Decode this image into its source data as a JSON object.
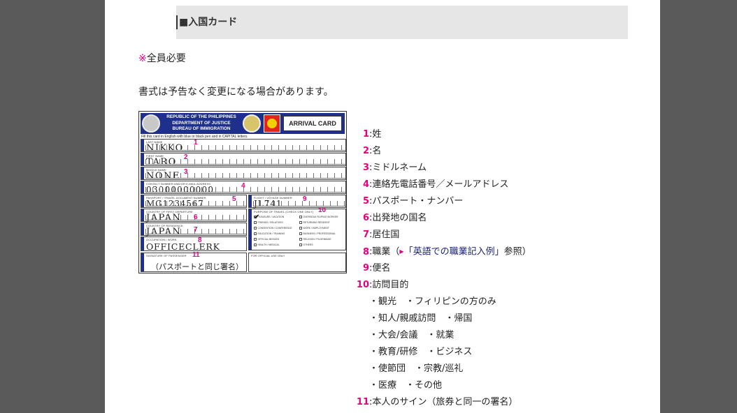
{
  "header": {
    "title": "■入国カード"
  },
  "note": {
    "mark": "※",
    "text": "全員必要"
  },
  "disclaimer": "書式は予告なく変更になる場合があります。",
  "card": {
    "head_lines": [
      "REPUBLIC OF THE PHILIPPINES",
      "DEPARTMENT OF JUSTICE",
      "BUREAU OF IMMIGRATION"
    ],
    "badge": "ARRIVAL CARD",
    "instruction": "Fill this card in English with blue or black pen and in CAPITAL letters.",
    "fields": {
      "last_name": {
        "label": "LAST NAME",
        "value": "NIKKO"
      },
      "first_name": {
        "label": "FIRST NAME",
        "value": "TARO"
      },
      "middle_name": {
        "label": "MIDDLE NAME",
        "value": "NONE"
      },
      "contact": {
        "label": "CONTACT NUMBER AND/OR E-MAIL ADDRESS",
        "value": "03000000000"
      },
      "passport": {
        "label": "PASSPORT / TRAVEL DOCUMENT NUMBER",
        "value": "MG1234567"
      },
      "flight": {
        "label": "FLIGHT / VOYAGE NUMBER",
        "value": "JL741"
      },
      "country_departure": {
        "label": "COUNTRY OF FIRST DEPARTURE",
        "value": "JAPAN"
      },
      "country_residence": {
        "label": "COUNTRY OF RESIDENCE",
        "value": "JAPAN"
      },
      "occupation": {
        "label": "OCCUPATION / WORK",
        "value": "OFFICECLERK"
      },
      "signature": {
        "label": "SIGNATURE OF PASSENGER",
        "value": "（パスポートと同じ署名）"
      },
      "official": {
        "label": "FOR OFFICIAL USE ONLY"
      }
    },
    "purpose": {
      "label": "PURPOSE OF TRAVEL (check one only)",
      "left": [
        "PLEASURE / VACATION",
        "FRIENDS / RELATIVES",
        "CONVENTION / CONFERENCE",
        "EDUCATION / TRAINING",
        "OFFICIAL MISSION",
        "HEALTH / MEDICAL"
      ],
      "right": [
        "OVERSEAS FILIPINO WORKER",
        "RETURNING RESIDENT",
        "WORK / EMPLOYMENT",
        "BUSINESS / PROFESSIONAL",
        "RELIGION / PILGRIMAGE",
        "OTHERS"
      ]
    },
    "check_mark": "✔",
    "numbers": [
      "1",
      "2",
      "3",
      "4",
      "5",
      "9",
      "10",
      "6",
      "7",
      "8",
      "11"
    ]
  },
  "legend": [
    {
      "num": "1",
      "colon": ":",
      "text": "姓"
    },
    {
      "num": "2",
      "colon": ":",
      "text": "名"
    },
    {
      "num": "3",
      "colon": ":",
      "text": "ミドルネーム"
    },
    {
      "num": "4",
      "colon": ":",
      "text": "連絡先電話番号／メールアドレス"
    },
    {
      "num": "5",
      "colon": ":",
      "text": "パスポート・ナンバー"
    },
    {
      "num": "6",
      "colon": ":",
      "text": "出発地の国名"
    },
    {
      "num": "7",
      "colon": ":",
      "text": "居住国"
    },
    {
      "num": "8",
      "colon": ":",
      "text": "職業（",
      "arrow": "▶",
      "link": "「英語での職業記入例」",
      "after": "参照）"
    },
    {
      "num": "9",
      "colon": ":",
      "text": "便名"
    },
    {
      "num": "10",
      "colon": ":",
      "text": "訪問目的"
    }
  ],
  "purposes": [
    "・観光　・フィリピンの方のみ",
    "・知人/親戚訪問　・帰国",
    "・大会/会議　・就業",
    "・教育/研修　・ビジネス",
    "・使節団　・宗教/巡礼",
    "・医療　・その他"
  ],
  "legend_last": {
    "num": "11",
    "colon": ":",
    "text": "本人のサイン（旅券と同一の署名）"
  }
}
